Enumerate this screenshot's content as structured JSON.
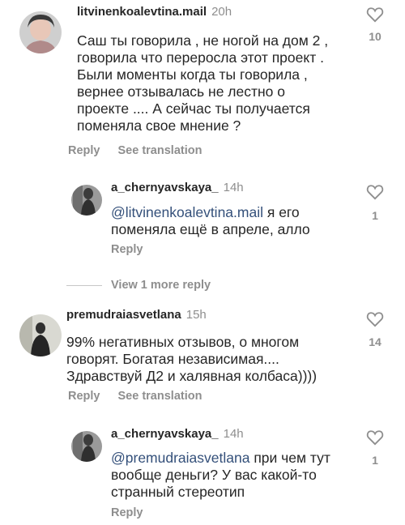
{
  "comments": [
    {
      "username": "litvinenkoalevtina.mail",
      "time": "20h",
      "text": "Саш ты говорила , не ногой на дом 2 , говорила что переросла этот проект . Были моменты когда ты говорила , вернее отзывалась не лестно о проекте .... А сейчас ты получается поменяла свое мнение ?",
      "likes": "10",
      "reply_label": "Reply",
      "translate_label": "See translation",
      "avatar_icon": "user-avatar-photo"
    },
    {
      "username": "a_chernyavskaya_",
      "time": "14h",
      "mention": "@litvinenkoalevtina.mail",
      "text": " я его поменяла ещё в апреле, алло",
      "likes": "1",
      "reply_label": "Reply",
      "avatar_icon": "user-avatar-photo"
    },
    {
      "username": "premudraiasvetlana",
      "time": "15h",
      "text": "99% негативных отзывов, о многом говорят.  Богатая независимая.... Здравствуй Д2 и халявная колбаса))))",
      "likes": "14",
      "reply_label": "Reply",
      "translate_label": "See translation",
      "avatar_icon": "user-avatar-photo"
    },
    {
      "username": "a_chernyavskaya_",
      "time": "14h",
      "mention": "@premudraiasvetlana",
      "text": " при чем тут вообще деньги? У вас какой-то странный стереотип",
      "likes": "1",
      "reply_label": "Reply",
      "avatar_icon": "user-avatar-photo"
    }
  ],
  "view_more_label": "View 1 more reply",
  "colors": {
    "mention": "#34507a",
    "muted": "#8e8e8e",
    "text": "#262626"
  }
}
